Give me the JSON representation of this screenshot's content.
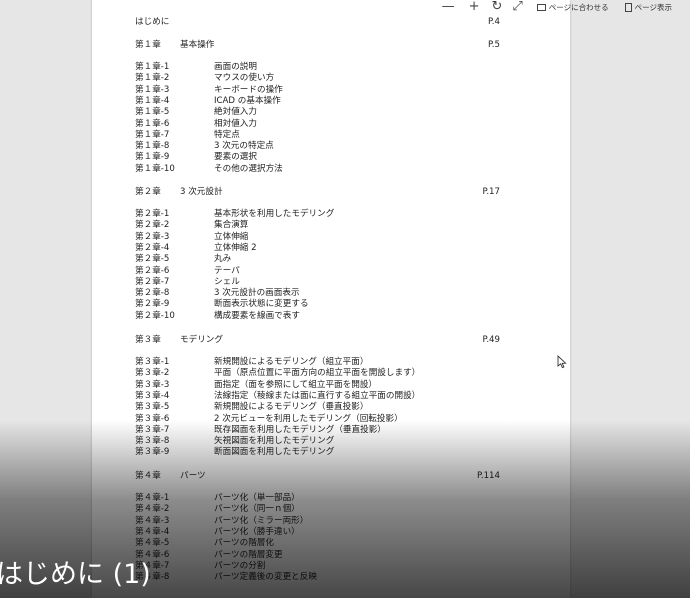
{
  "toolbar": {
    "zoom_out": "—",
    "zoom_in": "+",
    "rotate": "↻",
    "fullscreen": "⤢",
    "fit_page_label": "ページに合わせる",
    "page_view_label": "ページ表示"
  },
  "document": {
    "intro": {
      "title": "はじめに",
      "page": "P.4"
    },
    "chapters": [
      {
        "num": "第１章",
        "title": "基本操作",
        "page": "P.5",
        "items": [
          {
            "num": "第１章-1",
            "title": "画面の説明"
          },
          {
            "num": "第１章-2",
            "title": "マウスの使い方"
          },
          {
            "num": "第１章-3",
            "title": "キーボードの操作"
          },
          {
            "num": "第１章-4",
            "title": "ICAD の基本操作"
          },
          {
            "num": "第１章-5",
            "title": "絶対値入力"
          },
          {
            "num": "第１章-6",
            "title": "相対値入力"
          },
          {
            "num": "第１章-7",
            "title": "特定点"
          },
          {
            "num": "第１章-8",
            "title": "3 次元の特定点"
          },
          {
            "num": "第１章-9",
            "title": "要素の選択"
          },
          {
            "num": "第１章-10",
            "title": "その他の選択方法"
          }
        ]
      },
      {
        "num": "第２章",
        "title": "3 次元設計",
        "page": "P.17",
        "items": [
          {
            "num": "第２章-1",
            "title": "基本形状を利用したモデリング"
          },
          {
            "num": "第２章-2",
            "title": "集合演算"
          },
          {
            "num": "第２章-3",
            "title": "立体伸縮"
          },
          {
            "num": "第２章-4",
            "title": "立体伸縮 2"
          },
          {
            "num": "第２章-5",
            "title": "丸み"
          },
          {
            "num": "第２章-6",
            "title": "テーパ"
          },
          {
            "num": "第２章-7",
            "title": "シェル"
          },
          {
            "num": "第２章-8",
            "title": "3 次元設計の画面表示"
          },
          {
            "num": "第２章-9",
            "title": "断面表示状態に変更する"
          },
          {
            "num": "第２章-10",
            "title": "構成要素を線画で表す"
          }
        ]
      },
      {
        "num": "第３章",
        "title": "モデリング",
        "page": "P.49",
        "items": [
          {
            "num": "第３章-1",
            "title": "新規開設によるモデリング（組立平面）"
          },
          {
            "num": "第３章-2",
            "title": "平面（原点位置に平面方向の組立平面を開設します）"
          },
          {
            "num": "第３章-3",
            "title": "面指定（面を参照にして組立平面を開設）"
          },
          {
            "num": "第３章-4",
            "title": "法線指定（稜線または面に直行する組立平面の開設）"
          },
          {
            "num": "第３章-5",
            "title": "新規開設によるモデリング（垂直投影）"
          },
          {
            "num": "第３章-6",
            "title": "2 次元ビューを利用したモデリング（回転投影）"
          },
          {
            "num": "第３章-7",
            "title": "既存図面を利用したモデリング（垂直投影）"
          },
          {
            "num": "第３章-8",
            "title": "矢視図面を利用したモデリング"
          },
          {
            "num": "第３章-9",
            "title": "断面図面を利用したモデリング"
          }
        ]
      },
      {
        "num": "第４章",
        "title": "パーツ",
        "page": "P.114",
        "items": [
          {
            "num": "第４章-1",
            "title": "パーツ化（単一部品）"
          },
          {
            "num": "第４章-2",
            "title": "パーツ化（同一ｎ個）"
          },
          {
            "num": "第４章-3",
            "title": "パーツ化（ミラー両形）"
          },
          {
            "num": "第４章-4",
            "title": "パーツ化（勝手違い）"
          },
          {
            "num": "第４章-5",
            "title": "パーツの階層化"
          },
          {
            "num": "第４章-6",
            "title": "パーツの階層変更"
          },
          {
            "num": "第４章-7",
            "title": "パーツの分割"
          },
          {
            "num": "第４章-8",
            "title": "パーツ定義後の変更と反映"
          }
        ]
      }
    ]
  },
  "caption": "はじめに (1)"
}
